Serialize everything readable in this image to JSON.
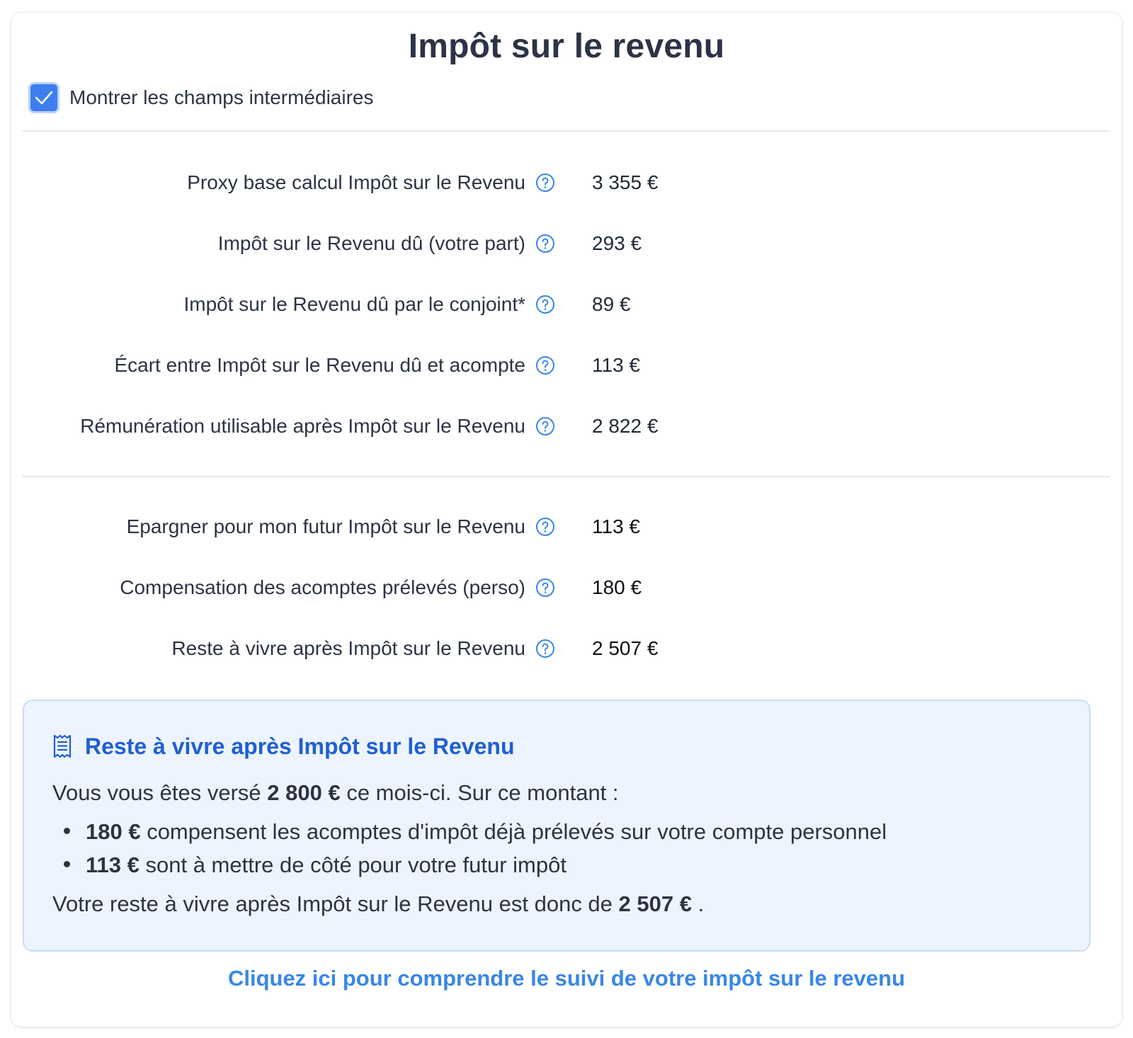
{
  "title": "Impôt sur le revenu",
  "toggle": {
    "label": "Montrer les champs intermédiaires",
    "checked": true
  },
  "section1": [
    {
      "label": "Proxy base calcul Impôt sur le Revenu",
      "value": "3 355 €"
    },
    {
      "label": "Impôt sur le Revenu dû (votre part)",
      "value": "293 €"
    },
    {
      "label": "Impôt sur le Revenu dû par le conjoint*",
      "value": "89 €"
    },
    {
      "label": "Écart entre Impôt sur le Revenu dû et acompte",
      "value": "113 €"
    },
    {
      "label": "Rémunération utilisable après Impôt sur le Revenu",
      "value": "2 822 €"
    }
  ],
  "section2": [
    {
      "label": "Epargner pour mon futur Impôt sur le Revenu",
      "value": "113 €"
    },
    {
      "label": "Compensation des acomptes prélevés (perso)",
      "value": "180 €"
    },
    {
      "label": "Reste à vivre après Impôt sur le Revenu",
      "value": "2 507 €"
    }
  ],
  "summary": {
    "title": "Reste à vivre après Impôt sur le Revenu",
    "intro_before": "Vous vous êtes versé ",
    "intro_amount": "2 800 €",
    "intro_after": " ce mois-ci. Sur ce montant :",
    "bullets": [
      {
        "amount": "180 €",
        "text": " compensent les acomptes d'impôt déjà prélevés sur votre compte personnel"
      },
      {
        "amount": "113 €",
        "text": " sont à mettre de côté pour votre futur impôt"
      }
    ],
    "conclusion_before": "Votre reste à vivre après Impôt sur le Revenu est donc de ",
    "conclusion_amount": "2 507 €",
    "conclusion_after": " ."
  },
  "link_text": "Cliquez ici pour comprendre le suivi de votre impôt sur le revenu",
  "colors": {
    "accent": "#3c7df0",
    "summary_title": "#1f5fd1",
    "link": "#3a86e6",
    "info_bg": "#edf4fd"
  },
  "icons": {
    "checkbox": "check-icon",
    "help": "question-circle-icon",
    "summary": "receipt-icon"
  }
}
